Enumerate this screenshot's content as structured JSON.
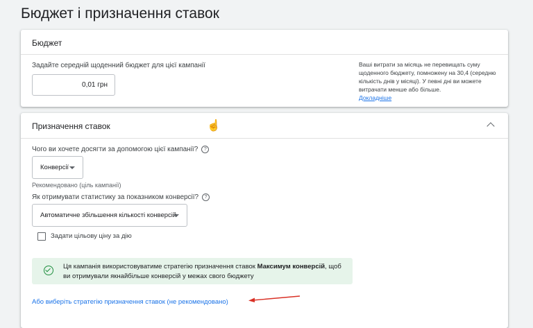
{
  "page": {
    "title": "Бюджет і призначення ставок"
  },
  "budget": {
    "header": "Бюджет",
    "prompt": "Задайте середній щоденний бюджет для цієї кампанії",
    "amount": "0,01 грн",
    "note": "Ваші витрати за місяць не перевищать суму щоденного бюджету, помножену на 30,4 (середню кількість днів у місяці). У певні дні ви можете витрачати менше або більше.",
    "note_link": "Докладніше"
  },
  "bidding": {
    "header": "Призначення ставок",
    "goal_question": "Чого ви хочете досягти за допомогою цієї кампанії?",
    "goal_value": "Конверсії",
    "goal_hint": "Рекомендовано (ціль кампанії)",
    "measure_question": "Як отримувати статистику за показником конверсії?",
    "measure_value": "Автоматичне збільшення кількості конверсій",
    "target_checkbox_label": "Задати цільову ціну за дію",
    "info_text_before": "Ця кампанія використовуватиме стратегію призначення ставок ",
    "info_text_bold": "Максимум конверсій",
    "info_text_after": ", щоб ви отримували якнайбільше конверсій у межах свого бюджету",
    "alt_strategy_link": "Або виберіть стратегію призначення ставок (не рекомендовано)"
  },
  "icons": {
    "help": "help-icon",
    "dropdown": "caret-down-icon",
    "collapse": "chevron-up-icon",
    "success": "check-circle-icon",
    "cursor": "hand-pointer-icon",
    "annotation": "red-arrow-icon"
  },
  "colors": {
    "accent": "#1a73e8",
    "success_bg": "#e6f4ea",
    "success_icon": "#1e8e3e",
    "annotation": "#d93025"
  }
}
